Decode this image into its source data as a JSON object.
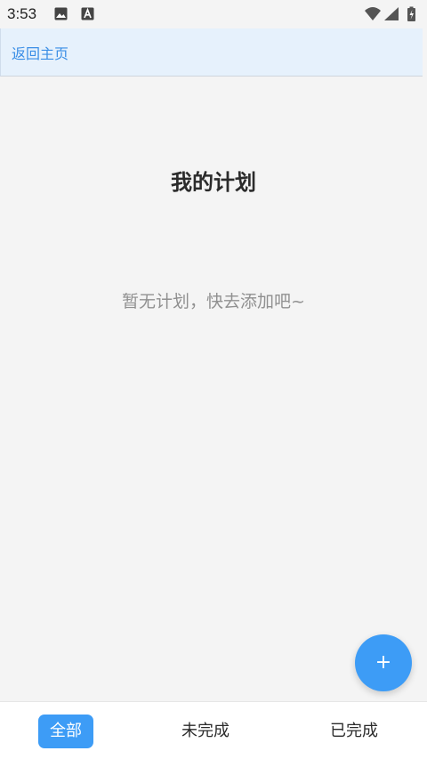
{
  "status_bar": {
    "time": "3:53",
    "left_icons": [
      "gallery-icon",
      "app-a-icon"
    ],
    "right_icons": [
      "wifi-icon",
      "signal-icon",
      "battery-icon"
    ]
  },
  "nav": {
    "back_label": "返回主页"
  },
  "main": {
    "title": "我的计划",
    "empty_message": "暂无计划，快去添加吧~"
  },
  "fab": {
    "label": "+"
  },
  "tabs": [
    {
      "label": "全部",
      "active": true
    },
    {
      "label": "未完成",
      "active": false
    },
    {
      "label": "已完成",
      "active": false
    }
  ],
  "colors": {
    "accent": "#3d9cf6",
    "link": "#3a8ee6",
    "back_bar_bg": "#e6f1fc",
    "page_bg": "#f4f4f4"
  }
}
